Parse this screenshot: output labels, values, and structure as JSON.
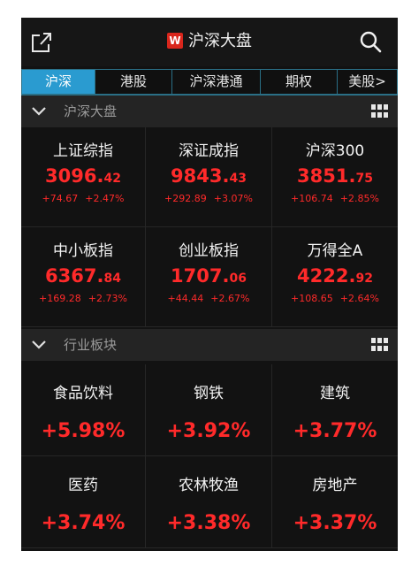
{
  "header": {
    "title": "沪深大盘",
    "badge": "W",
    "share_icon": "share-icon",
    "search_icon": "search-icon"
  },
  "tabs": [
    {
      "label": "沪深",
      "active": true
    },
    {
      "label": "港股",
      "active": false
    },
    {
      "label": "沪深港通",
      "active": false
    },
    {
      "label": "期权",
      "active": false
    },
    {
      "label": "美股>",
      "active": false
    }
  ],
  "market_section": {
    "title": "沪深大盘",
    "indices": [
      {
        "name": "上证综指",
        "value_int": "3096.",
        "value_dec": "42",
        "change": "+74.67",
        "pct": "+2.47%"
      },
      {
        "name": "深证成指",
        "value_int": "9843.",
        "value_dec": "43",
        "change": "+292.89",
        "pct": "+3.07%"
      },
      {
        "name": "沪深300",
        "value_int": "3851.",
        "value_dec": "75",
        "change": "+106.74",
        "pct": "+2.85%"
      },
      {
        "name": "中小板指",
        "value_int": "6367.",
        "value_dec": "84",
        "change": "+169.28",
        "pct": "+2.73%"
      },
      {
        "name": "创业板指",
        "value_int": "1707.",
        "value_dec": "06",
        "change": "+44.44",
        "pct": "+2.67%"
      },
      {
        "name": "万得全A",
        "value_int": "4222.",
        "value_dec": "92",
        "change": "+108.65",
        "pct": "+2.64%"
      }
    ]
  },
  "industry_section": {
    "title": "行业板块",
    "sectors": [
      {
        "name": "食品饮料",
        "pct": "+5.98%"
      },
      {
        "name": "钢铁",
        "pct": "+3.92%"
      },
      {
        "name": "建筑",
        "pct": "+3.77%"
      },
      {
        "name": "医药",
        "pct": "+3.74%"
      },
      {
        "name": "农林牧渔",
        "pct": "+3.38%"
      },
      {
        "name": "房地产",
        "pct": "+3.37%"
      }
    ]
  },
  "colors": {
    "up": "#ff2a2a",
    "active_tab": "#2a9bd0",
    "brand": "#d9261c"
  }
}
